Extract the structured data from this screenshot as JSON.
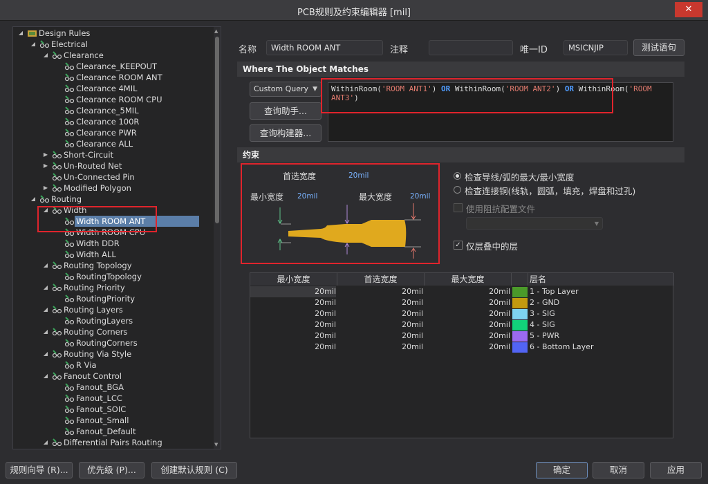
{
  "window": {
    "title": "PCB规则及约束编辑器 [mil]",
    "close_glyph": "✕"
  },
  "tree": {
    "rows": [
      {
        "label": "Design Rules",
        "expander": "◢",
        "icon": "design-rules-folder-icon"
      },
      {
        "label": "Electrical",
        "expander": "◢",
        "icon": "rule-category-icon"
      },
      {
        "label": "Clearance",
        "expander": "◢",
        "icon": "rule-type-icon"
      },
      {
        "label": "Clearance_KEEPOUT",
        "expander": "",
        "icon": "rule-icon"
      },
      {
        "label": "Clearance ROOM ANT",
        "expander": "",
        "icon": "rule-icon"
      },
      {
        "label": "Clearance 4MIL",
        "expander": "",
        "icon": "rule-icon"
      },
      {
        "label": "Clearance ROOM CPU",
        "expander": "",
        "icon": "rule-icon"
      },
      {
        "label": "Clearance_5MIL",
        "expander": "",
        "icon": "rule-icon"
      },
      {
        "label": "Clearance 100R",
        "expander": "",
        "icon": "rule-icon"
      },
      {
        "label": "Clearance PWR",
        "expander": "",
        "icon": "rule-icon"
      },
      {
        "label": "Clearance ALL",
        "expander": "",
        "icon": "rule-icon"
      },
      {
        "label": "Short-Circuit",
        "expander": "▶",
        "icon": "rule-type-icon"
      },
      {
        "label": "Un-Routed Net",
        "expander": "▶",
        "icon": "rule-type-icon"
      },
      {
        "label": "Un-Connected Pin",
        "expander": "",
        "icon": "rule-type-icon"
      },
      {
        "label": "Modified Polygon",
        "expander": "▶",
        "icon": "rule-type-icon"
      },
      {
        "label": "Routing",
        "expander": "◢",
        "icon": "rule-category-icon"
      },
      {
        "label": "Width",
        "expander": "◢",
        "icon": "rule-type-icon"
      },
      {
        "label": "Width ROOM ANT",
        "expander": "",
        "icon": "rule-icon"
      },
      {
        "label": "Width ROOM CPU",
        "expander": "",
        "icon": "rule-icon"
      },
      {
        "label": "Width DDR",
        "expander": "",
        "icon": "rule-icon"
      },
      {
        "label": "Width ALL",
        "expander": "",
        "icon": "rule-icon"
      },
      {
        "label": "Routing Topology",
        "expander": "◢",
        "icon": "rule-type-icon"
      },
      {
        "label": "RoutingTopology",
        "expander": "",
        "icon": "rule-icon"
      },
      {
        "label": "Routing Priority",
        "expander": "◢",
        "icon": "rule-type-icon"
      },
      {
        "label": "RoutingPriority",
        "expander": "",
        "icon": "rule-icon"
      },
      {
        "label": "Routing Layers",
        "expander": "◢",
        "icon": "rule-type-icon"
      },
      {
        "label": "RoutingLayers",
        "expander": "",
        "icon": "rule-icon"
      },
      {
        "label": "Routing Corners",
        "expander": "◢",
        "icon": "rule-type-icon"
      },
      {
        "label": "RoutingCorners",
        "expander": "",
        "icon": "rule-icon"
      },
      {
        "label": "Routing Via Style",
        "expander": "◢",
        "icon": "rule-type-icon"
      },
      {
        "label": "R Via",
        "expander": "",
        "icon": "rule-icon"
      },
      {
        "label": "Fanout Control",
        "expander": "◢",
        "icon": "rule-type-icon"
      },
      {
        "label": "Fanout_BGA",
        "expander": "",
        "icon": "rule-icon"
      },
      {
        "label": "Fanout_LCC",
        "expander": "",
        "icon": "rule-icon"
      },
      {
        "label": "Fanout_SOIC",
        "expander": "",
        "icon": "rule-icon"
      },
      {
        "label": "Fanout_Small",
        "expander": "",
        "icon": "rule-icon"
      },
      {
        "label": "Fanout_Default",
        "expander": "",
        "icon": "rule-icon"
      },
      {
        "label": "Differential Pairs Routing",
        "expander": "◢",
        "icon": "rule-type-icon"
      }
    ]
  },
  "header": {
    "name_label": "名称",
    "name_value": "Width ROOM ANT",
    "comment_label": "注释",
    "comment_value": "",
    "uid_label": "唯一ID",
    "uid_value": "MSICNJIP",
    "test_button": "测试语句"
  },
  "where": {
    "section_title": "Where The Object Matches",
    "query_type": "Custom Query",
    "query_helper_button": "查询助手... ",
    "query_builder_button": "查询构建器... ",
    "query_parts": [
      {
        "t": "WithinRoom(",
        "c": "fn"
      },
      {
        "t": "'ROOM ANT1'",
        "c": "st"
      },
      {
        "t": ") ",
        "c": "fn"
      },
      {
        "t": "OR",
        "c": "kw"
      },
      {
        "t": " WithinRoom(",
        "c": "fn"
      },
      {
        "t": "'ROOM ANT2'",
        "c": "st"
      },
      {
        "t": ") ",
        "c": "fn"
      },
      {
        "t": "OR",
        "c": "kw"
      },
      {
        "t": " WithinRoom(",
        "c": "fn"
      },
      {
        "t": "'ROOM ANT3'",
        "c": "st"
      },
      {
        "t": ")",
        "c": "fn"
      }
    ]
  },
  "constraints": {
    "section_title": "约束",
    "preferred_width_label": "首选宽度",
    "preferred_width_value": "20mil",
    "min_width_label": "最小宽度",
    "min_width_value": "20mil",
    "max_width_label": "最大宽度",
    "max_width_value": "20mil",
    "trace_color": "#e0a91e",
    "radio_trace": "检查导线/弧的最大/最小宽度",
    "radio_copper": "检查连接铜(线轨，圆弧，填充，焊盘和过孔)",
    "impedance_checkbox": "使用阻抗配置文件",
    "impedance_checked": false,
    "layer_stack_checkbox": "仅层叠中的层",
    "layer_stack_checked": true,
    "check_glyph": "✓"
  },
  "layer_table": {
    "headers": [
      "最小宽度",
      "首选宽度",
      "最大宽度",
      "",
      "层名"
    ],
    "rows": [
      {
        "min": "20mil",
        "pref": "20mil",
        "max": "20mil",
        "color": "#4b9a2a",
        "layer": "1 - Top Layer"
      },
      {
        "min": "20mil",
        "pref": "20mil",
        "max": "20mil",
        "color": "#c29a0f",
        "layer": "2 - GND"
      },
      {
        "min": "20mil",
        "pref": "20mil",
        "max": "20mil",
        "color": "#7ed3f1",
        "layer": "3 - SIG"
      },
      {
        "min": "20mil",
        "pref": "20mil",
        "max": "20mil",
        "color": "#12d27a",
        "layer": "4 - SIG"
      },
      {
        "min": "20mil",
        "pref": "20mil",
        "max": "20mil",
        "color": "#9a6af0",
        "layer": "5 - PWR"
      },
      {
        "min": "20mil",
        "pref": "20mil",
        "max": "20mil",
        "color": "#5264f4",
        "layer": "6 - Bottom Layer"
      }
    ]
  },
  "footer": {
    "wizard_button": "规则向导 (R)...",
    "priority_button": "优先级 (P)...",
    "default_rules_button": "创建默认规则 (C)",
    "ok_button": "确定",
    "cancel_button": "取消",
    "apply_button": "应用"
  }
}
